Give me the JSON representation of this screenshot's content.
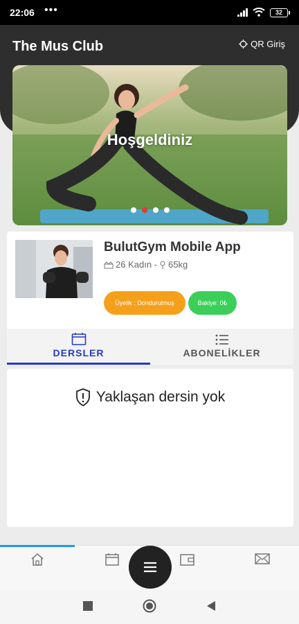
{
  "status": {
    "time": "22:06",
    "battery": "32"
  },
  "header": {
    "title": "The Mus Club",
    "qr_label": "QR Giriş"
  },
  "hero": {
    "title": "Hoşgeldiniz"
  },
  "profile": {
    "name": "BulutGym Mobile App",
    "meta": "26 Kadın - ",
    "weight": "65kg",
    "membership_badge": "Üyelik : Dondurulmuş",
    "balance_badge": "Bakiye: 0₺"
  },
  "tabs": [
    {
      "label": "DERSLER",
      "icon": "calendar-icon",
      "active": true
    },
    {
      "label": "ABONELİKLER",
      "icon": "list-icon",
      "active": false
    }
  ],
  "content": {
    "empty_message": "Yaklaşan dersin yok"
  },
  "bottom_nav": [
    {
      "icon": "home-icon"
    },
    {
      "icon": "calendar-icon"
    },
    {
      "icon": "menu-icon"
    },
    {
      "icon": "wallet-icon"
    },
    {
      "icon": "mail-icon"
    }
  ],
  "colors": {
    "accent": "#2539c7",
    "header_bg": "#2e2e2e",
    "badge_orange": "#f5a01a",
    "badge_green": "#3bcf5a",
    "active_dot": "#e53935"
  }
}
